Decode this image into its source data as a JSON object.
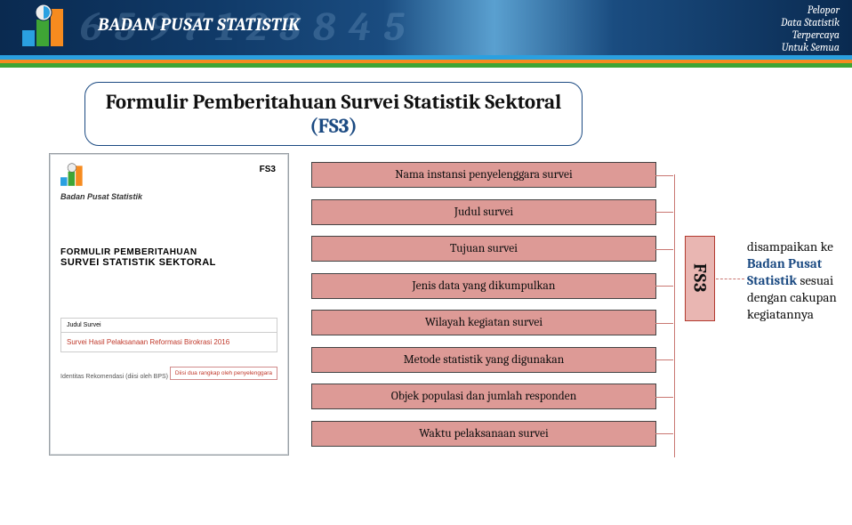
{
  "banner": {
    "org_name": "BADAN PUSAT STATISTIK",
    "bg_digits": "6 5 9 7 1 2 3 8 4 5",
    "tagline_l1": "Pelopor",
    "tagline_l2": "Data Statistik",
    "tagline_l3": "Terpercaya",
    "tagline_l4": "Untuk Semua"
  },
  "title": {
    "prefix": "Formulir Pemberitahuan Survei Statistik Sektoral",
    "suffix": "(FS3)"
  },
  "preview": {
    "org": "Badan Pusat Statistik",
    "code": "FS3",
    "line1": "FORMULIR PEMBERITAHUAN",
    "line2": "SURVEI STATISTIK SEKTORAL",
    "box_label": "Judul Survei",
    "box_value": "Survei Hasil Pelaksanaan Reformasi Birokrasi 2016",
    "foot_left": "Identitas Rekomendasi (diisi oleh BPS)",
    "foot_right": "Diisi dua rangkap oleh penyelenggara"
  },
  "list": {
    "items": [
      "Nama instansi penyelenggara survei",
      "Judul survei",
      "Tujuan survei",
      "Jenis data yang dikumpulkan",
      "Wilayah kegiatan survei",
      "Metode statistik yang digunakan",
      "Objek populasi dan jumlah responden",
      "Waktu pelaksanaan survei"
    ]
  },
  "fs3_tab": "FS3",
  "desc": {
    "part1": "disampaikan ke ",
    "hl": "Badan Pusat Statistik",
    "part2": " sesuai dengan cakupan kegiatannya"
  },
  "colors": {
    "brand_blue": "#1b4a82",
    "box_fill": "#dd9a96",
    "box_border": "#444444",
    "accent_red": "#b23a2f"
  }
}
